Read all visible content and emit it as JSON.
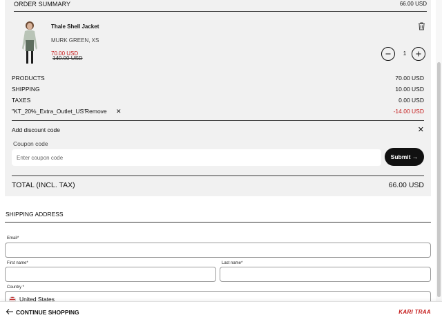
{
  "summary": {
    "title": "ORDER SUMMARY",
    "header_total": "66.00 USD",
    "product": {
      "name": "Thale Shell Jacket",
      "variant": "MURK GREEN, XS",
      "sale_price": "70.00 USD",
      "original_price": "140.00 USD",
      "quantity": "1"
    },
    "rows": {
      "products": {
        "label": "PRODUCTS",
        "value": "70.00 USD"
      },
      "shipping": {
        "label": "SHIPPING",
        "value": "10.00 USD"
      },
      "taxes": {
        "label": "TAXES",
        "value": "0.00 USD"
      },
      "discount": {
        "code": "\"KT_20%_Extra_Outlet_US\"",
        "remove": "Remove",
        "value": "-14.00 USD"
      }
    },
    "discount_section": {
      "title": "Add discount code",
      "coupon_label": "Coupon code",
      "coupon_placeholder": "Enter coupon code",
      "submit": "Submit →"
    },
    "total": {
      "label": "TOTAL (INCL. TAX)",
      "value": "66.00 USD"
    }
  },
  "shipping": {
    "title": "SHIPPING ADDRESS",
    "email_label": "Email*",
    "first_name_label": "First name*",
    "last_name_label": "Last name*",
    "country_label": "Country *",
    "country_value": "United States"
  },
  "footer": {
    "continue": "CONTINUE SHOPPING",
    "brand": "KARI TRAA"
  },
  "colors": {
    "sale": "#c41a1a",
    "card_bg": "#f1f1f1",
    "button_bg": "#111111"
  },
  "icons": [
    "trash-icon",
    "minus-icon",
    "plus-icon",
    "close-icon",
    "arrow-left-icon",
    "us-flag-icon"
  ]
}
